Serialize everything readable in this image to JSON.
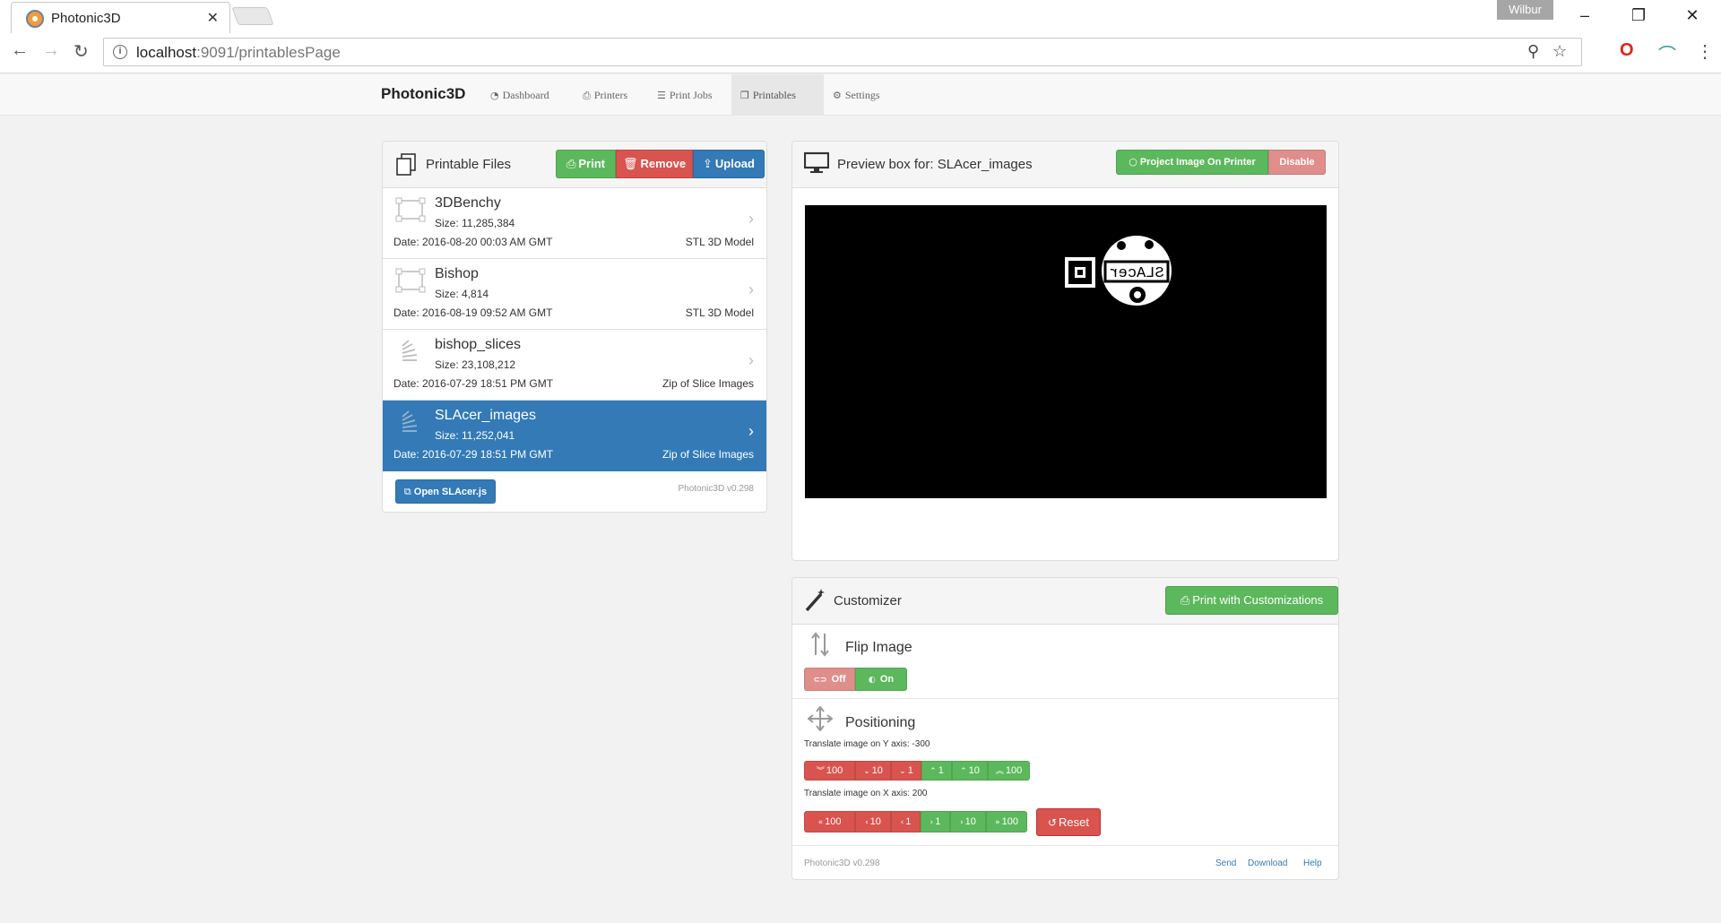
{
  "browser": {
    "tab_title": "Photonic3D",
    "url_host": "localhost",
    "url_path": ":9091/printablesPage",
    "profile": "Wilbur"
  },
  "navbar": {
    "brand": "Photonic3D",
    "items": [
      {
        "label": "Dashboard",
        "icon": "dashboard-icon"
      },
      {
        "label": "Printers",
        "icon": "printer-icon"
      },
      {
        "label": "Print Jobs",
        "icon": "list-icon"
      },
      {
        "label": "Printables",
        "icon": "files-icon"
      },
      {
        "label": "Settings",
        "icon": "gears-icon"
      }
    ],
    "active": "Printables"
  },
  "printables": {
    "title": "Printable Files",
    "print_label": "Print",
    "remove_label": "Remove",
    "upload_label": "Upload",
    "files": [
      {
        "name": "3DBenchy",
        "size": "Size: 11,285,384",
        "date": "Date: 2016-08-20 00:03 AM GMT",
        "type": "STL 3D Model",
        "icon": "3d-model-icon"
      },
      {
        "name": "Bishop",
        "size": "Size: 4,814",
        "date": "Date: 2016-08-19 09:52 AM GMT",
        "type": "STL 3D Model",
        "icon": "3d-model-icon"
      },
      {
        "name": "bishop_slices",
        "size": "Size: 23,108,212",
        "date": "Date: 2016-07-29 18:51 PM GMT",
        "type": "Zip of Slice Images",
        "icon": "slices-icon"
      },
      {
        "name": "SLAcer_images",
        "size": "Size: 11,252,041",
        "date": "Date: 2016-07-29 18:51 PM GMT",
        "type": "Zip of Slice Images",
        "icon": "slices-icon"
      }
    ],
    "selected": "SLAcer_images",
    "open_slacer_label": "Open SLAcer.js",
    "version": "Photonic3D v0.298"
  },
  "preview": {
    "title": "Preview box for: SLAcer_images",
    "project_label": "Project Image On Printer",
    "disable_label": "Disable",
    "image_text": "SLAcer"
  },
  "customizer": {
    "title": "Customizer",
    "print_custom_label": "Print with Customizations",
    "flip_title": "Flip Image",
    "flip_off": "Off",
    "flip_on": "On",
    "positioning_title": "Positioning",
    "y_label": "Translate image on Y axis: -300",
    "x_label": "Translate image on X axis: 200",
    "y_buttons": [
      "100",
      "10",
      "1",
      "1",
      "10",
      "100"
    ],
    "x_buttons": [
      "100",
      "10",
      "1",
      "1",
      "10",
      "100"
    ],
    "reset_label": "Reset",
    "version": "Photonic3D v0.298",
    "links": [
      "Send",
      "Download",
      "Help"
    ]
  },
  "colors": {
    "green": "#5cb85c",
    "red": "#d9534f",
    "blue": "#337ab7",
    "disabled_red": "#e08e8b"
  }
}
